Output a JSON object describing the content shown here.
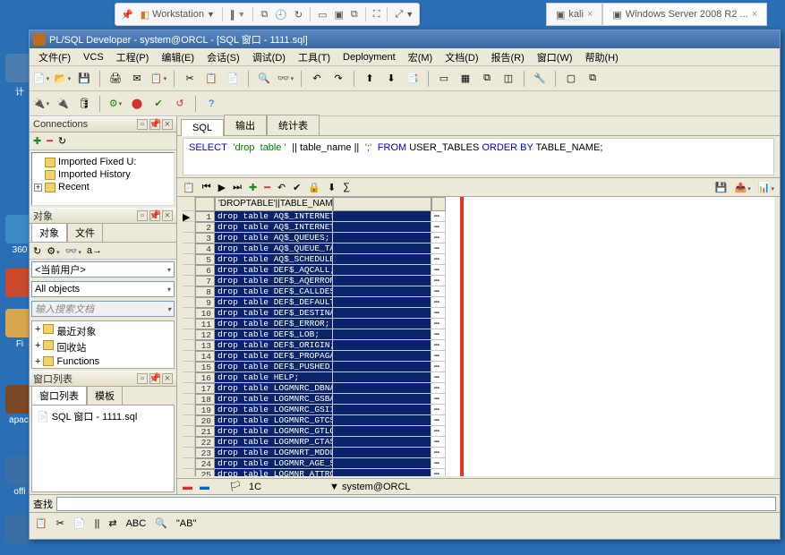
{
  "vm": {
    "workstation": "Workstation",
    "tab1": "kali",
    "tab2": "Windows Server 2008 R2 ..."
  },
  "title": "PL/SQL Developer - system@ORCL - [SQL 窗口 - 1111.sql]",
  "menu": [
    "文件(F)",
    "VCS",
    "工程(P)",
    "编辑(E)",
    "会话(S)",
    "调试(D)",
    "工具(T)",
    "Deployment",
    "宏(M)",
    "文档(D)",
    "报告(R)",
    "窗口(W)",
    "帮助(H)"
  ],
  "panels": {
    "connections": "Connections",
    "obj": "对象",
    "objTabs": {
      "obj": "对象",
      "file": "文件"
    },
    "currentUser": "<当前用户>",
    "allObjects": "All objects",
    "inputHint": "输入搜索文档",
    "winlist": "窗口列表",
    "winTabs": {
      "list": "窗口列表",
      "tpl": "模板"
    },
    "sqlWin": "SQL 窗口 - 1111.sql",
    "search": "查找"
  },
  "tree": {
    "n1": "Imported Fixed U:",
    "n2": "Imported History",
    "n3": "Recent"
  },
  "funcs": {
    "a": "最近对象",
    "b": "回收站",
    "c": "Functions"
  },
  "rcTabs": {
    "sql": "SQL",
    "out": "输出",
    "stat": "统计表"
  },
  "sql": {
    "p1": "SELECT",
    "p2": "'drop  table '",
    "p3": "|| table_name ||",
    "p4": "';'",
    "p5": "FROM",
    "p6": " USER_TABLES ",
    "p7": "ORDER BY",
    "p8": " TABLE_NAME;"
  },
  "gridHead": {
    "c1": "'DROPTABLE'||TABLE_NAME||';'",
    "c2": "",
    "c3": ""
  },
  "rows": [
    {
      "n": "1",
      "a": "drop  table AQ$_INTERNET_AGENTS;"
    },
    {
      "n": "2",
      "a": "drop  table AQ$_INTERNET_AGENT_PRIVS;"
    },
    {
      "n": "3",
      "a": "drop  table AQ$_QUEUES;"
    },
    {
      "n": "4",
      "a": "drop  table AQ$_QUEUE_TABLES;"
    },
    {
      "n": "5",
      "a": "drop  table AQ$_SCHEDULES;"
    },
    {
      "n": "6",
      "a": "drop  table DEF$_AQCALL;"
    },
    {
      "n": "7",
      "a": "drop  table DEF$_AQERROR;"
    },
    {
      "n": "8",
      "a": "drop  table DEF$_CALLDEST;"
    },
    {
      "n": "9",
      "a": "drop  table DEF$_DEFAULTDEST;"
    },
    {
      "n": "10",
      "a": "drop  table DEF$_DESTINATION;"
    },
    {
      "n": "11",
      "a": "drop  table DEF$_ERROR;"
    },
    {
      "n": "12",
      "a": "drop  table DEF$_LOB;"
    },
    {
      "n": "13",
      "a": "drop  table DEF$_ORIGIN;"
    },
    {
      "n": "14",
      "a": "drop  table DEF$_PROPAGATOR;"
    },
    {
      "n": "15",
      "a": "drop  table DEF$_PUSHED_TRANSACTIONS;"
    },
    {
      "n": "16",
      "a": "drop  table HELP;"
    },
    {
      "n": "17",
      "a": "drop  table LOGMNRC_DBNAME_UID_MAP;"
    },
    {
      "n": "18",
      "a": "drop  table LOGMNRC_GSBA;"
    },
    {
      "n": "19",
      "a": "drop  table LOGMNRC_GSII;"
    },
    {
      "n": "20",
      "a": "drop  table LOGMNRC_GTCS;"
    },
    {
      "n": "21",
      "a": "drop  table LOGMNRC_GTLO;"
    },
    {
      "n": "22",
      "a": "drop  table LOGMNRP_CTAS_PART_MAP;"
    },
    {
      "n": "23",
      "a": "drop  table LOGMNRT_MDDL$;"
    },
    {
      "n": "24",
      "a": "drop  table LOGMNR_AGE_SPILL$;"
    },
    {
      "n": "25",
      "a": "drop  table LOGMNR_ATTRCOL$;"
    }
  ],
  "status": {
    "rows": "1C",
    "conn": "system@ORCL"
  },
  "bstat": {
    "txt": "\"AB\"",
    "abc": "ABC"
  }
}
